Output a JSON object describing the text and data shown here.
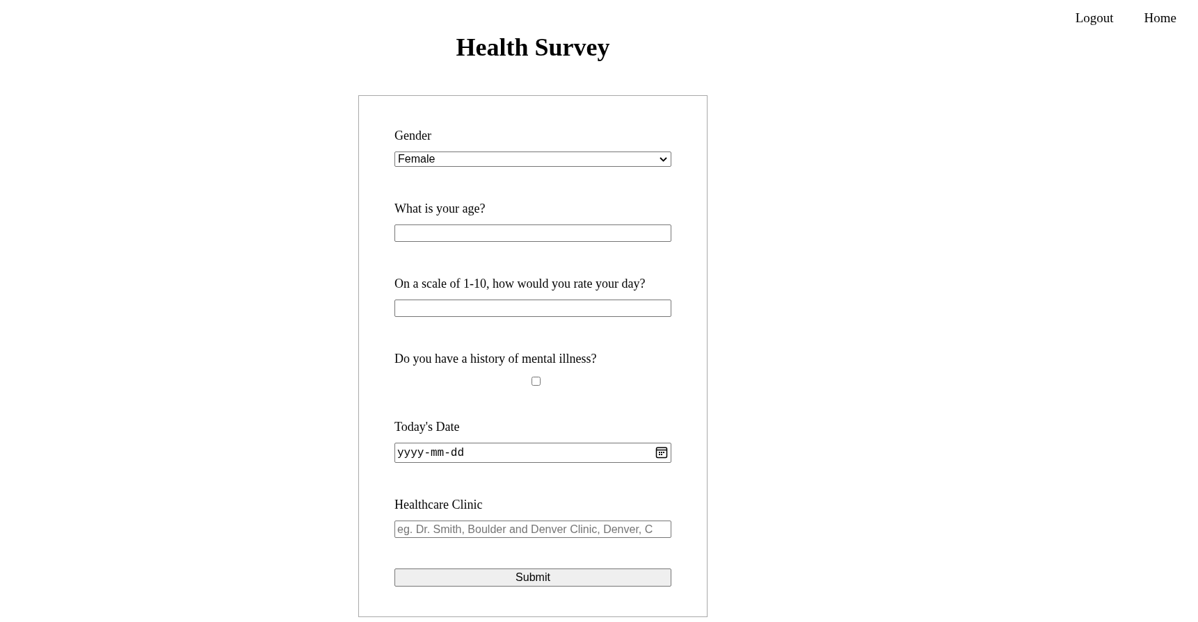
{
  "nav": [
    {
      "label": "Logout"
    },
    {
      "label": "Home"
    }
  ],
  "title": "Health Survey",
  "form": {
    "fields": [
      {
        "kind": "select",
        "label": "Gender",
        "value": "Female"
      },
      {
        "kind": "text",
        "label": "What is your age?"
      },
      {
        "kind": "text",
        "label": "On a scale of 1-10, how would you rate your day?"
      },
      {
        "kind": "checkbox",
        "label": "Do you have a history of mental illness?",
        "checked": false
      },
      {
        "kind": "date",
        "label": "Today's Date",
        "placeholder": "yyyy-mm-dd"
      },
      {
        "kind": "text",
        "label": "Healthcare Clinic",
        "placeholder": "eg. Dr. Smith, Boulder and Denver Clinic, Denver, C"
      }
    ],
    "submit": "Submit"
  }
}
